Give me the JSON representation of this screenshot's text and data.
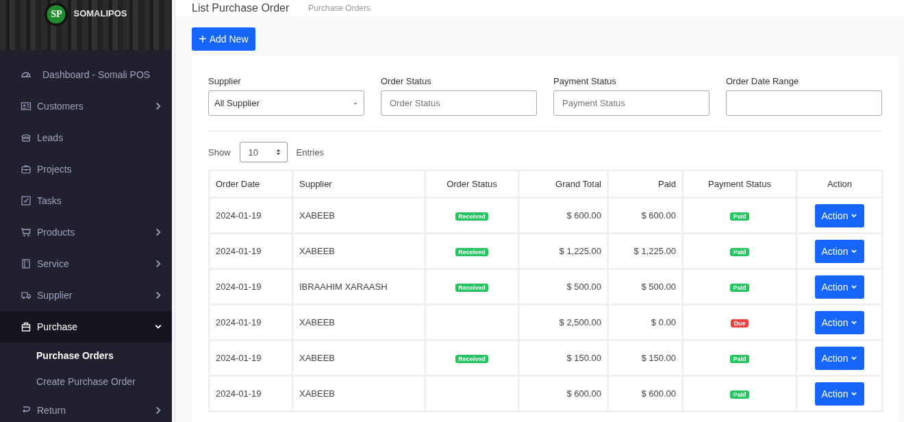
{
  "brand": {
    "name": "SOMALIPOS",
    "logo_text": "SP"
  },
  "sidebar": {
    "items": [
      {
        "label": "Dashboard - Somali POS",
        "expandable": false,
        "selected": false
      },
      {
        "label": "Customers",
        "expandable": true,
        "expanded": false,
        "selected": false
      },
      {
        "label": "Leads",
        "expandable": false,
        "selected": false
      },
      {
        "label": "Projects",
        "expandable": false,
        "selected": false
      },
      {
        "label": "Tasks",
        "expandable": false,
        "selected": false
      },
      {
        "label": "Products",
        "expandable": true,
        "expanded": false,
        "selected": false
      },
      {
        "label": "Service",
        "expandable": true,
        "expanded": false,
        "selected": false
      },
      {
        "label": "Supplier",
        "expandable": true,
        "expanded": false,
        "selected": false
      },
      {
        "label": "Purchase",
        "expandable": true,
        "expanded": true,
        "selected": true,
        "children": [
          {
            "label": "Purchase Orders",
            "selected": true
          },
          {
            "label": "Create Purchase Order",
            "selected": false
          }
        ]
      },
      {
        "label": "Return",
        "expandable": true,
        "expanded": false,
        "selected": false
      }
    ]
  },
  "page": {
    "title": "List Purchase Order",
    "breadcrumb": "Purchase Orders"
  },
  "add_button": {
    "icon": "+",
    "label": "Add New"
  },
  "filters": [
    {
      "kind": "select",
      "label": "Supplier",
      "value": "All Supplier"
    },
    {
      "kind": "input",
      "label": "Order Status",
      "placeholder": "Order Status"
    },
    {
      "kind": "input",
      "label": "Payment Status",
      "placeholder": "Payment Status"
    },
    {
      "kind": "input",
      "label": "Order Date Range"
    }
  ],
  "length": {
    "prefix": "Show",
    "value": "10",
    "suffix": "Entries"
  },
  "table": {
    "columns": [
      "Order Date",
      "Supplier",
      "Order Status",
      "Grand Total",
      "Paid",
      "Payment Status",
      "Action"
    ],
    "rows": [
      {
        "order_date": "2024-01-19",
        "supplier": "XABEEB",
        "order_status": {
          "text": "Received",
          "color": "#22c55e"
        },
        "grand_total": "$ 600.00",
        "paid": "$ 600.00",
        "payment_status": {
          "text": "Paid",
          "color": "#22c55e"
        },
        "action": "Action"
      },
      {
        "order_date": "2024-01-19",
        "supplier": "XABEEB",
        "order_status": {
          "text": "Received",
          "color": "#22c55e"
        },
        "grand_total": "$ 1,225.00",
        "paid": "$ 1,225.00",
        "payment_status": {
          "text": "Paid",
          "color": "#22c55e"
        },
        "action": "Action"
      },
      {
        "order_date": "2024-01-19",
        "supplier": "IBRAAHIM XARAASH",
        "order_status": {
          "text": "Received",
          "color": "#22c55e"
        },
        "grand_total": "$ 500.00",
        "paid": "$ 500.00",
        "payment_status": {
          "text": "Paid",
          "color": "#22c55e"
        },
        "action": "Action"
      },
      {
        "order_date": "2024-01-19",
        "supplier": "XABEEB",
        "grand_total": "$ 2,500.00",
        "paid": "$ 0.00",
        "payment_status": {
          "text": "Due",
          "color": "#ef4444"
        },
        "action": "Action"
      },
      {
        "order_date": "2024-01-19",
        "supplier": "XABEEB",
        "order_status": {
          "text": "Received",
          "color": "#22c55e"
        },
        "grand_total": "$ 150.00",
        "paid": "$ 150.00",
        "payment_status": {
          "text": "Paid",
          "color": "#22c55e"
        },
        "action": "Action"
      },
      {
        "order_date": "2024-01-19",
        "supplier": "XABEEB",
        "grand_total": "$ 600.00",
        "paid": "$ 600.00",
        "payment_status": {
          "text": "Paid",
          "color": "#22c55e"
        },
        "action": "Action"
      }
    ]
  }
}
